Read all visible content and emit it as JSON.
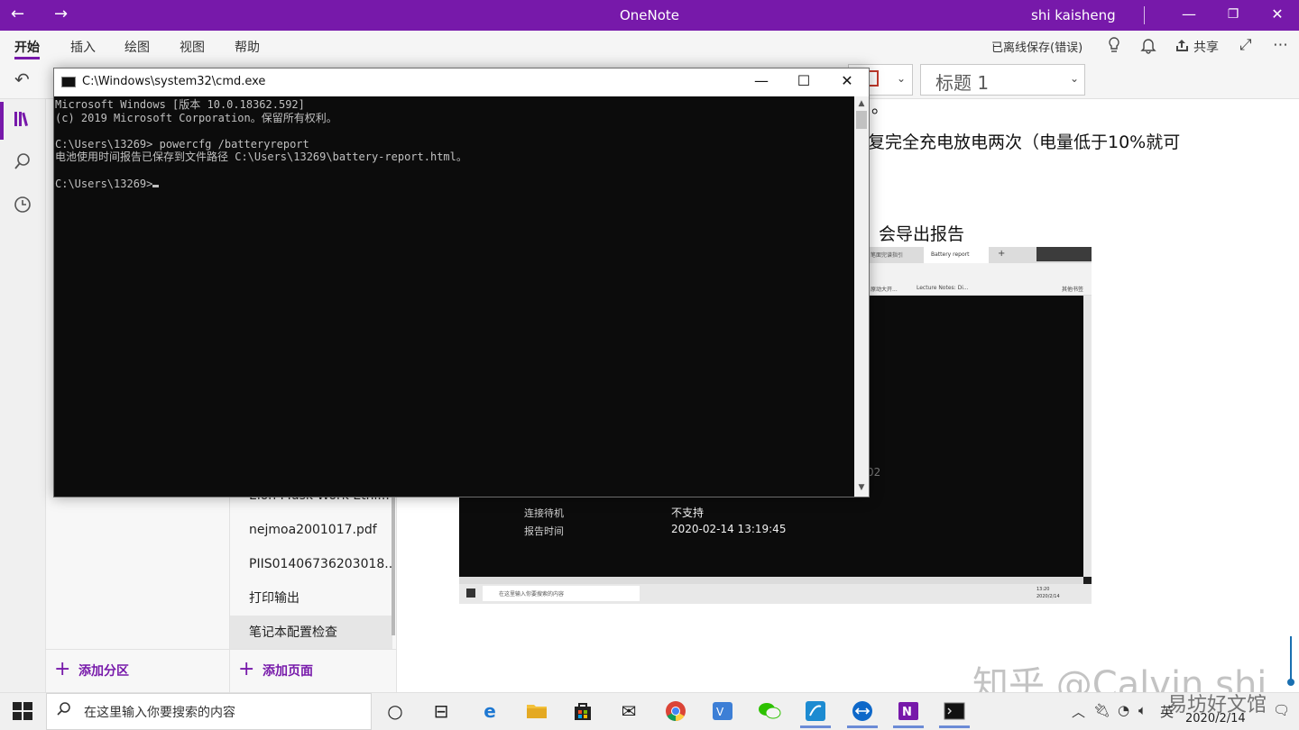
{
  "titlebar": {
    "app_title": "OneNote",
    "user_name": "shi kaisheng",
    "back_icon": "back-arrow-icon",
    "forward_icon": "forward-arrow-icon"
  },
  "ribbon": {
    "tabs": [
      "开始",
      "插入",
      "绘图",
      "视图",
      "帮助"
    ],
    "active_tab": "开始",
    "sync_status": "已离线保存(错误)",
    "share_label": "共享",
    "accent_color": "#7719aa"
  },
  "toolbar": {
    "style_value": "标题 1"
  },
  "pages": {
    "items": [
      "Elon Musk Work Ethi...",
      "nejmoa2001017.pdf",
      "PIIS01406736203018...",
      "打印输出",
      "笔记本配置检查"
    ],
    "selected": "笔记本配置检查",
    "add_section_label": "添加分区",
    "add_page_label": "添加页面"
  },
  "note": {
    "line1": "。",
    "line2": "复完全充电放电两次（电量低于10%就可",
    "line3": "会导出报告"
  },
  "embedded_screenshot": {
    "tab1": "笔面完谱指引",
    "tab_active": "Battery report",
    "bookmark1": "原动大开...",
    "bookmark2": "Lecture Notes: Di...",
    "bookmark3": "其他书签",
    "partial_value": "02",
    "rows": [
      {
        "label": "连接待机",
        "value": "不支持"
      },
      {
        "label": "报告时间",
        "value": "2020-02-14  13:19:45"
      }
    ],
    "search_placeholder": "在这里输入你要搜索的内容",
    "clock_time": "13:20",
    "clock_date": "2020/2/14"
  },
  "cmd": {
    "title": "C:\\Windows\\system32\\cmd.exe",
    "lines": [
      "Microsoft Windows [版本 10.0.18362.592]",
      "(c) 2019 Microsoft Corporation。保留所有权利。",
      "",
      "C:\\Users\\13269> powercfg /batteryreport",
      "电池使用时间报告已保存到文件路径 C:\\Users\\13269\\battery-report.html。",
      "",
      "C:\\Users\\13269>"
    ]
  },
  "watermark": {
    "zhihu": "知乎 @Calvin shi",
    "site": "易坊好文馆"
  },
  "taskbar": {
    "search_placeholder": "在这里输入你要搜索的内容",
    "ime_label": "英",
    "date": "2020/2/14"
  }
}
